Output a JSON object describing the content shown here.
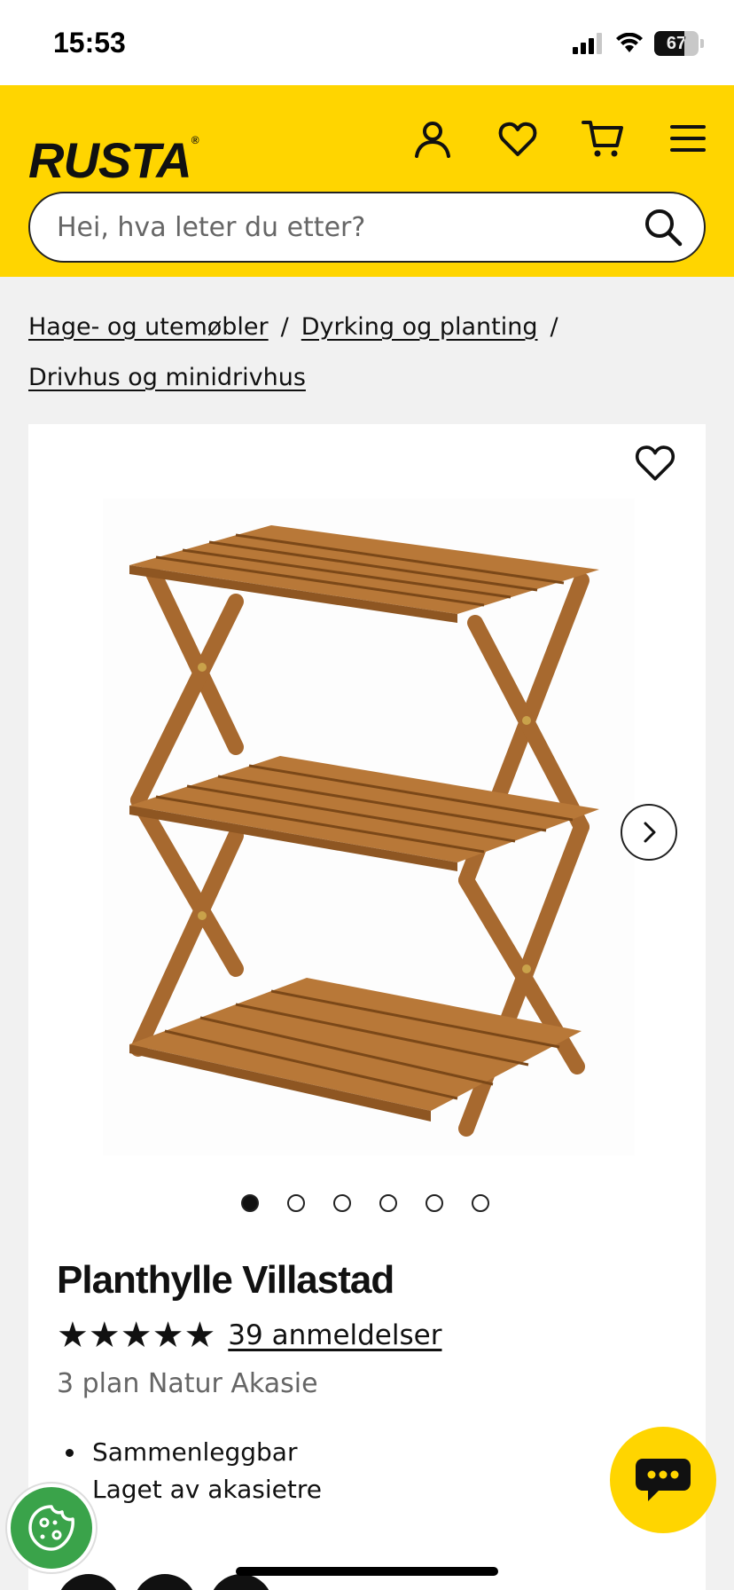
{
  "status_bar": {
    "time": "15:53",
    "battery": "67",
    "icons": [
      "signal-icon",
      "wifi-icon",
      "battery-icon"
    ]
  },
  "header": {
    "logo": "RUSTA",
    "logo_mark": "®",
    "background_color": "#ffd500",
    "icons": [
      "account-icon",
      "heart-icon",
      "cart-icon",
      "menu-icon"
    ],
    "search": {
      "placeholder": "Hei, hva leter du etter?",
      "value": ""
    }
  },
  "breadcrumb": {
    "items": [
      {
        "label": "Hage- og utemøbler"
      },
      {
        "label": "Dyrking og planting"
      },
      {
        "label": "Drivhus og minidrivhus"
      }
    ],
    "separator": "/"
  },
  "product": {
    "title": "Planthylle Villastad",
    "rating_stars": 5,
    "star_glyph": "★★★★★",
    "reviews_label": "39 anmeldelser",
    "subtitle": "3 plan Natur Akasie",
    "features": [
      "Sammenleggbar",
      "Laget av akasietre"
    ],
    "image_icon": "folding-plant-shelf-image",
    "gallery": {
      "count": 6,
      "active_index": 0
    }
  },
  "floating": {
    "chat_icon": "chat-bubble-icon",
    "cookie_icon": "cookie-icon",
    "chat_color": "#ffd500",
    "cookie_color": "#3aa34a"
  }
}
